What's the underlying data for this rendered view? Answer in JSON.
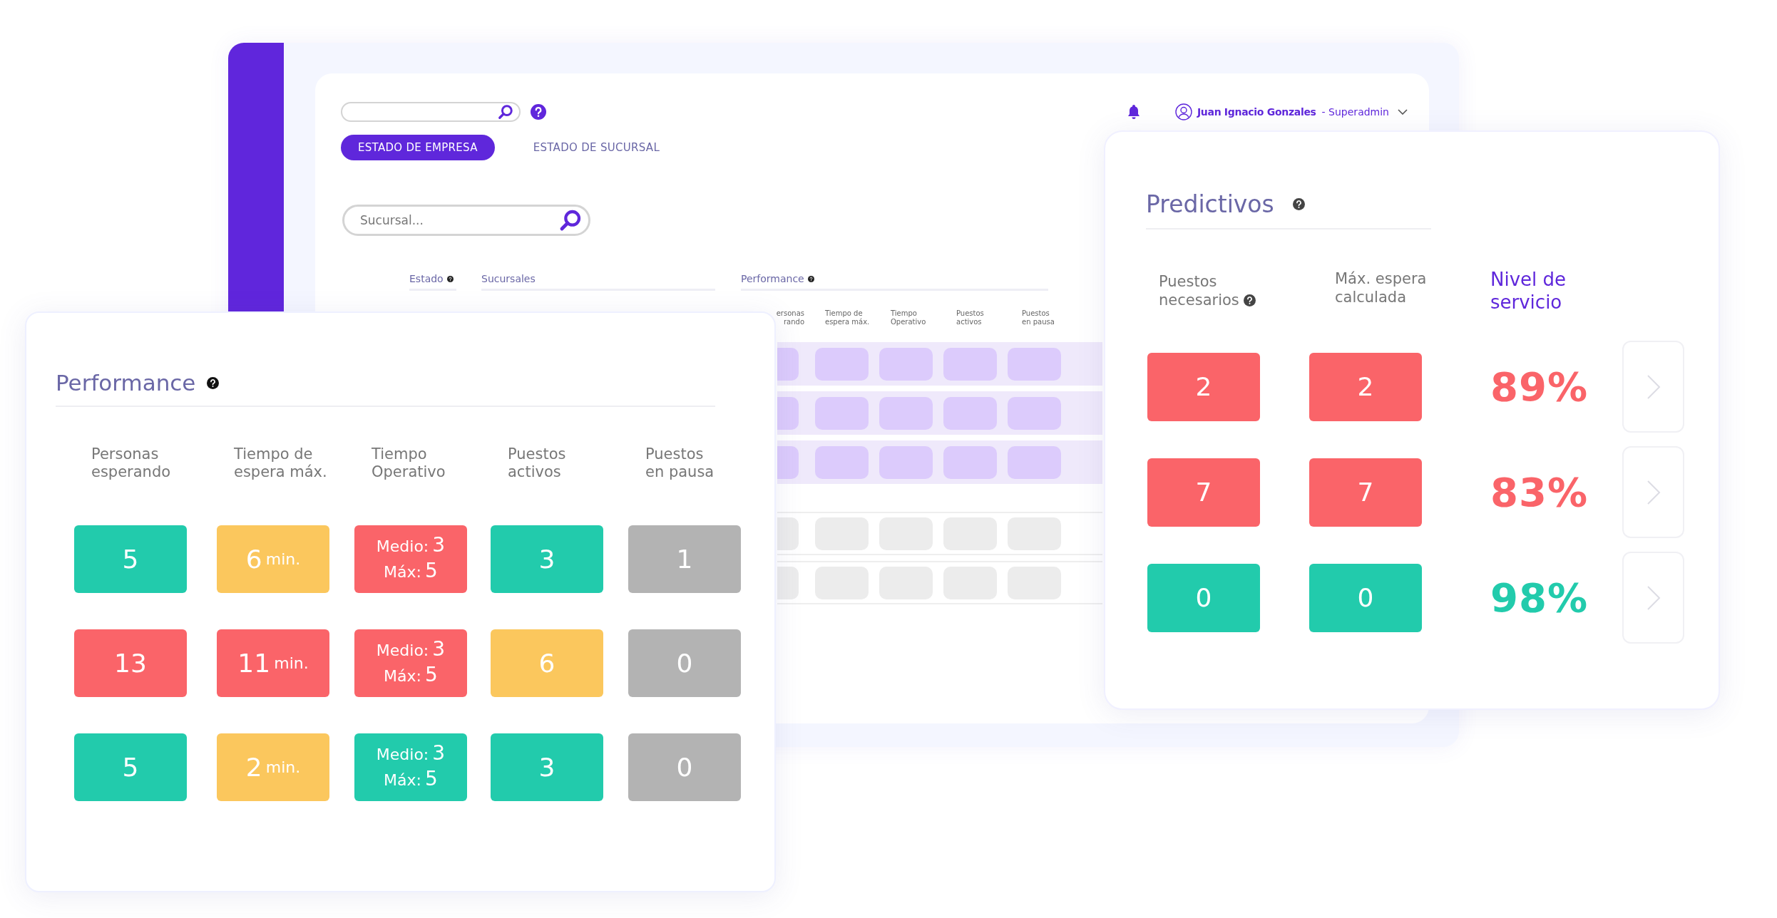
{
  "dashboard": {
    "user": {
      "name": "Juan Ignacio Gonzales",
      "role": "- Superadmin"
    },
    "tabs": [
      {
        "label": "ESTADO DE EMPRESA",
        "selected": true
      },
      {
        "label": "ESTADO DE SUCURSAL",
        "selected": false
      }
    ],
    "branch_search": {
      "placeholder": "Sucursal..."
    },
    "table": {
      "groups": [
        {
          "label": "Estado",
          "help": true
        },
        {
          "label": "Sucursales",
          "help": false
        },
        {
          "label": "Performance",
          "help": true
        }
      ],
      "subheaders": [
        "ersonas\nrando",
        "Tiempo de\nespera máx.",
        "Tiempo\nOperativo",
        "Puestos\nactivos",
        "Puestos\nen pausa"
      ],
      "rows": [
        {
          "highlighted": true
        },
        {
          "highlighted": true
        },
        {
          "highlighted": true
        },
        {
          "highlighted": false
        },
        {
          "highlighted": false
        }
      ]
    }
  },
  "performance": {
    "title": "Performance",
    "help": true,
    "columns": [
      "Personas\nesperando",
      "Tiempo de\nespera máx.",
      "Tiempo\nOperativo",
      "Puestos\nactivos",
      "Puestos\nen pausa"
    ],
    "rows": [
      [
        {
          "kind": "count",
          "value": "5",
          "color": "#22cbac"
        },
        {
          "kind": "time",
          "value": "6",
          "unit": "min.",
          "color": "#fbc75d"
        },
        {
          "kind": "range",
          "lines": [
            {
              "label": "Medio:",
              "value": "3"
            },
            {
              "label": "Máx:",
              "value": "5"
            }
          ],
          "color": "#fa6469"
        },
        {
          "kind": "count",
          "value": "3",
          "color": "#22cbac"
        },
        {
          "kind": "count",
          "value": "1",
          "color": "#b3b3b3"
        }
      ],
      [
        {
          "kind": "count",
          "value": "13",
          "color": "#fa6469"
        },
        {
          "kind": "time",
          "value": "11",
          "unit": "min.",
          "color": "#fa6469"
        },
        {
          "kind": "range",
          "lines": [
            {
              "label": "Medio:",
              "value": "3"
            },
            {
              "label": "Máx:",
              "value": "5"
            }
          ],
          "color": "#fa6469"
        },
        {
          "kind": "count",
          "value": "6",
          "color": "#fbc75d"
        },
        {
          "kind": "count",
          "value": "0",
          "color": "#b3b3b3"
        }
      ],
      [
        {
          "kind": "count",
          "value": "5",
          "color": "#22cbac"
        },
        {
          "kind": "time",
          "value": "2",
          "unit": "min.",
          "color": "#fbc75d"
        },
        {
          "kind": "range",
          "lines": [
            {
              "label": "Medio:",
              "value": "3"
            },
            {
              "label": "Máx:",
              "value": "5"
            }
          ],
          "color": "#22cbac"
        },
        {
          "kind": "count",
          "value": "3",
          "color": "#22cbac"
        },
        {
          "kind": "count",
          "value": "0",
          "color": "#b3b3b3"
        }
      ]
    ]
  },
  "predictivos": {
    "title": "Predictivos",
    "help": true,
    "columns": [
      {
        "label": "Puestos\nnecesarios",
        "help": true,
        "highlighted": false
      },
      {
        "label": "Máx. espera\ncalculada",
        "help": false,
        "highlighted": false
      },
      {
        "label": "Nivel de\nservicio",
        "help": false,
        "highlighted": true
      }
    ],
    "rows": [
      {
        "needed": {
          "value": "2",
          "color": "#fa6469"
        },
        "max_wait": {
          "value": "2",
          "color": "#fa6469"
        },
        "service_level": {
          "value": "89%",
          "color": "#fa6469"
        }
      },
      {
        "needed": {
          "value": "7",
          "color": "#fa6469"
        },
        "max_wait": {
          "value": "7",
          "color": "#fa6469"
        },
        "service_level": {
          "value": "83%",
          "color": "#fa6469"
        }
      },
      {
        "needed": {
          "value": "0",
          "color": "#22cbac"
        },
        "max_wait": {
          "value": "0",
          "color": "#22cbac"
        },
        "service_level": {
          "value": "98%",
          "color": "#22cbac"
        }
      }
    ]
  }
}
